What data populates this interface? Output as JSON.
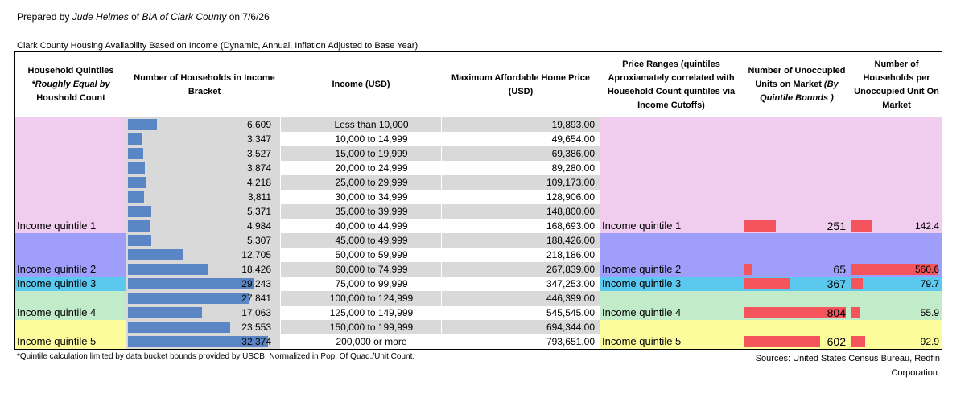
{
  "prepared": {
    "prefix": "Prepared by",
    "name": "Jude Helmes",
    "of": "of",
    "org": "BIA of Clark County",
    "on": "on 7/6/26"
  },
  "subtitle": "Clark County Housing Availability Based on Income (Dynamic, Annual, Inflation Adjusted to Base Year)",
  "headers": {
    "quintiles_line1": "Household Quintiles",
    "quintiles_line2": "*Roughly Equal by",
    "quintiles_line3": "Houshold Count",
    "households": "Number of Households in Income Bracket",
    "income": "Income (USD)",
    "max_price": "Maximum Affordable Home Price (USD)",
    "price_ranges": "Price Ranges (quintiles Aproxiamately correlated with Household Count quintiles via Income Cutoffs)",
    "unoccupied_line1": "Number of Unoccupied Units on Market",
    "unoccupied_line2": "(By Quintile Bounds )",
    "per_unit": "Number of Households per Unoccupied Unit On Market"
  },
  "rows": [
    {
      "households": "6,609",
      "households_value": 6609,
      "income": "Less than 10,000",
      "price": "19,893.00"
    },
    {
      "households": "3,347",
      "households_value": 3347,
      "income": "10,000 to 14,999",
      "price": "49,654.00"
    },
    {
      "households": "3,527",
      "households_value": 3527,
      "income": "15,000 to 19,999",
      "price": "69,386.00"
    },
    {
      "households": "3,874",
      "households_value": 3874,
      "income": "20,000 to 24,999",
      "price": "89,280.00"
    },
    {
      "households": "4,218",
      "households_value": 4218,
      "income": "25,000 to 29,999",
      "price": "109,173.00"
    },
    {
      "households": "3,811",
      "households_value": 3811,
      "income": "30,000 to 34,999",
      "price": "128,906.00"
    },
    {
      "households": "5,371",
      "households_value": 5371,
      "income": "35,000 to 39,999",
      "price": "148,800.00"
    },
    {
      "households": "4,984",
      "households_value": 4984,
      "income": "40,000 to 44,999",
      "price": "168,693.00"
    },
    {
      "households": "5,307",
      "households_value": 5307,
      "income": "45,000 to 49,999",
      "price": "188,426.00"
    },
    {
      "households": "12,705",
      "households_value": 12705,
      "income": "50,000 to 59,999",
      "price": "218,186.00"
    },
    {
      "households": "18,426",
      "households_value": 18426,
      "income": "60,000 to 74,999",
      "price": "267,839.00"
    },
    {
      "households": "29,243",
      "households_value": 29243,
      "income": "75,000 to 99,999",
      "price": "347,253.00"
    },
    {
      "households": "27,841",
      "households_value": 27841,
      "income": "100,000 to 124,999",
      "price": "446,399.00"
    },
    {
      "households": "17,063",
      "households_value": 17063,
      "income": "125,000 to 149,999",
      "price": "545,545.00"
    },
    {
      "households": "23,553",
      "households_value": 23553,
      "income": "150,000 to 199,999",
      "price": "694,344.00"
    },
    {
      "households": "32,374",
      "households_value": 32374,
      "income": "200,000 or more",
      "price": "793,651.00"
    }
  ],
  "households_scale_max": 32374,
  "quintiles": [
    {
      "label": "Income quintile 1",
      "price_label": "Income quintile 1",
      "unoccupied": "251",
      "unoccupied_value": 251,
      "per_unit": "142.4",
      "per_unit_value": 142.4,
      "color": "#f0cdee"
    },
    {
      "label": "Income quintile 2",
      "price_label": "Income quintile 2",
      "unoccupied": "65",
      "unoccupied_value": 65,
      "per_unit": "560.6",
      "per_unit_value": 560.6,
      "color": "#9f9ffb"
    },
    {
      "label": "Income quintile 3",
      "price_label": "Income quintile 3",
      "unoccupied": "367",
      "unoccupied_value": 367,
      "per_unit": "79.7",
      "per_unit_value": 79.7,
      "color": "#5bc8ef"
    },
    {
      "label": "Income quintile 4",
      "price_label": "Income quintile 4",
      "unoccupied": "804",
      "unoccupied_value": 804,
      "per_unit": "55.9",
      "per_unit_value": 55.9,
      "color": "#c2ebc9"
    },
    {
      "label": "Income quintile 5",
      "price_label": "Income quintile 5",
      "unoccupied": "602",
      "unoccupied_value": 602,
      "per_unit": "92.9",
      "per_unit_value": 92.9,
      "color": "#fdfc9d"
    }
  ],
  "unoccupied_scale_max": 804,
  "per_unit_scale_max": 560.6,
  "footnote": "*Quintile calculation limited by data bucket bounds provided by USCB. Normalized in Pop. Of Quad./Unit Count.",
  "sources": "Sources: United States Census Bureau, Redfin Corporation.",
  "colors": {
    "household_bar": "#5b86c5",
    "unit_bar": "#f4545c",
    "row_shade": "#d9d9d9"
  }
}
